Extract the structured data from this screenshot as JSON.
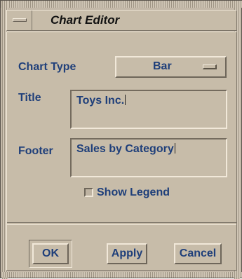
{
  "window": {
    "title": "Chart Editor"
  },
  "form": {
    "chart_type_label": "Chart Type",
    "chart_type_value": "Bar",
    "title_label": "Title",
    "title_value": "Toys Inc.",
    "footer_label": "Footer",
    "footer_value": "Sales by Category",
    "show_legend_label": "Show Legend",
    "show_legend_checked": false
  },
  "buttons": {
    "ok": "OK",
    "apply": "Apply",
    "cancel": "Cancel"
  },
  "colors": {
    "label_text": "#1f3f7a",
    "panel_bg": "#c7bca9"
  },
  "icons": {
    "window_menu": "window-menu-icon",
    "option_menu": "option-menu-indicator-icon"
  }
}
